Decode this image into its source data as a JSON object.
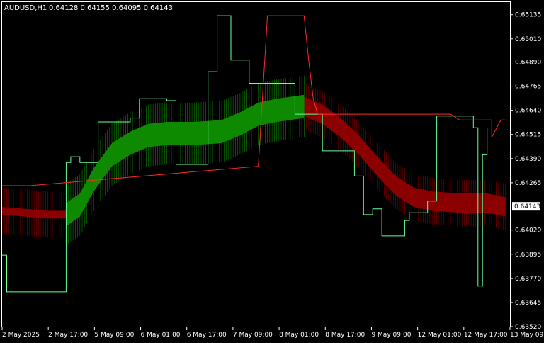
{
  "header": {
    "symbol": "AUDUSD,H1",
    "ohlc": "0.64128 0.64155 0.64095 0.64143"
  },
  "colors": {
    "background": "#000000",
    "axis": "#ffffff",
    "band_line": "#66ff99",
    "upper_line": "#ff2b2b",
    "bull_fill": "#0f8a00",
    "bear_fill": "#8b0000",
    "price_box": "#ffffff"
  },
  "chart_data": {
    "type": "line",
    "title": "AUDUSD,H1",
    "ylim": [
      0.6352,
      0.652
    ],
    "y_ticks": [
      "0.65135",
      "0.65010",
      "0.64890",
      "0.64765",
      "0.64640",
      "0.64515",
      "0.64390",
      "0.64265",
      "0.64143",
      "0.64020",
      "0.63895",
      "0.63770",
      "0.63645",
      "0.63520"
    ],
    "current_price": "0.64143",
    "x_ticks": [
      "2 May 2025",
      "2 May 17:00",
      "5 May 09:00",
      "6 May 01:00",
      "6 May 17:00",
      "7 May 09:00",
      "8 May 01:00",
      "8 May 17:00",
      "9 May 09:00",
      "12 May 01:00",
      "12 May 17:00",
      "13 May 09:00"
    ],
    "x_range": [
      0,
      111
    ],
    "series": [
      {
        "key": "step",
        "points": [
          [
            0,
            0.6389
          ],
          [
            1,
            0.6389
          ],
          [
            1,
            0.637
          ],
          [
            14,
            0.637
          ],
          [
            14,
            0.6437
          ],
          [
            15,
            0.6437
          ],
          [
            15,
            0.644
          ],
          [
            17,
            0.644
          ],
          [
            17,
            0.6437
          ],
          [
            21,
            0.6437
          ],
          [
            21,
            0.6458
          ],
          [
            28,
            0.6458
          ],
          [
            28,
            0.646
          ],
          [
            30,
            0.646
          ],
          [
            30,
            0.647
          ],
          [
            36,
            0.647
          ],
          [
            36,
            0.6469
          ],
          [
            38,
            0.6469
          ],
          [
            38,
            0.6466
          ],
          [
            38,
            0.6436
          ],
          [
            45,
            0.6436
          ],
          [
            45,
            0.6484
          ],
          [
            47,
            0.6484
          ],
          [
            47,
            0.6513
          ],
          [
            50,
            0.6513
          ],
          [
            50,
            0.649
          ],
          [
            54,
            0.649
          ],
          [
            54,
            0.6482
          ],
          [
            54,
            0.6478
          ],
          [
            64,
            0.6478
          ],
          [
            64,
            0.6462
          ],
          [
            70,
            0.6462
          ],
          [
            70,
            0.6443
          ],
          [
            77,
            0.6443
          ],
          [
            77,
            0.643
          ],
          [
            79,
            0.643
          ],
          [
            79,
            0.641
          ],
          [
            81,
            0.641
          ],
          [
            81,
            0.6413
          ],
          [
            83,
            0.6413
          ],
          [
            83,
            0.6399
          ],
          [
            88,
            0.6399
          ],
          [
            88,
            0.6407
          ],
          [
            89,
            0.6407
          ],
          [
            89,
            0.6411
          ],
          [
            93,
            0.6411
          ],
          [
            93,
            0.6417
          ],
          [
            95,
            0.6417
          ],
          [
            95,
            0.6461
          ],
          [
            103,
            0.6461
          ],
          [
            103,
            0.6455
          ],
          [
            104,
            0.6455
          ],
          [
            104,
            0.6373
          ],
          [
            105,
            0.6373
          ],
          [
            105,
            0.6441
          ],
          [
            106,
            0.6441
          ],
          [
            106,
            0.6455
          ]
        ]
      },
      {
        "key": "upper",
        "points": [
          [
            0,
            0.6425
          ],
          [
            6,
            0.6425
          ],
          [
            56,
            0.6435
          ],
          [
            58,
            0.6513
          ],
          [
            66,
            0.6513
          ],
          [
            67,
            0.649
          ],
          [
            68,
            0.647
          ],
          [
            69,
            0.6462
          ],
          [
            98,
            0.6462
          ],
          [
            100,
            0.6459
          ],
          [
            107,
            0.6459
          ],
          [
            107,
            0.645
          ],
          [
            109,
            0.6459
          ],
          [
            110,
            0.6459
          ]
        ]
      },
      {
        "key": "mid",
        "points": [
          [
            0,
            0.6412
          ],
          [
            10,
            0.641
          ],
          [
            14,
            0.641
          ],
          [
            17,
            0.6415
          ],
          [
            20,
            0.6428
          ],
          [
            24,
            0.6441
          ],
          [
            28,
            0.6447
          ],
          [
            32,
            0.6451
          ],
          [
            36,
            0.6452
          ],
          [
            42,
            0.6452
          ],
          [
            48,
            0.6453
          ],
          [
            52,
            0.6457
          ],
          [
            56,
            0.6462
          ],
          [
            60,
            0.6464
          ],
          [
            66,
            0.6466
          ],
          [
            70,
            0.6462
          ],
          [
            74,
            0.6455
          ],
          [
            78,
            0.6446
          ],
          [
            82,
            0.6435
          ],
          [
            86,
            0.6425
          ],
          [
            90,
            0.6419
          ],
          [
            94,
            0.6417
          ],
          [
            100,
            0.6416
          ],
          [
            106,
            0.6416
          ],
          [
            110,
            0.6414
          ]
        ]
      }
    ],
    "annotations": {
      "bull_range": [
        14,
        66
      ],
      "bear_range_left": [
        0,
        14
      ],
      "bear_range_right": [
        66,
        110
      ]
    }
  }
}
